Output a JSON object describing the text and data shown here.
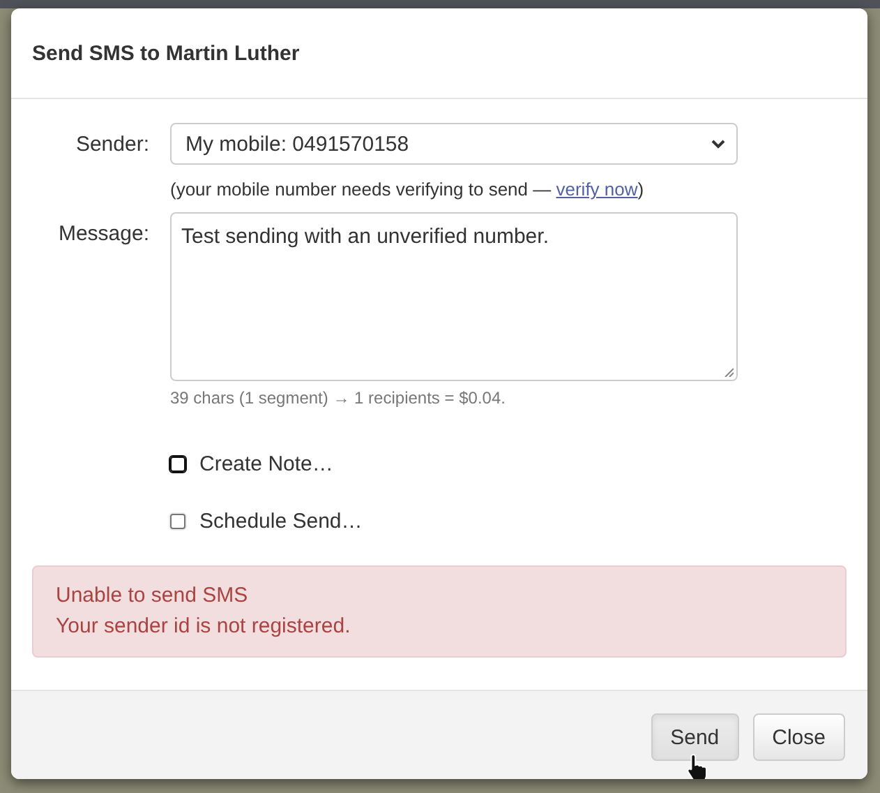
{
  "dialog": {
    "title": "Send SMS to Martin Luther"
  },
  "sender": {
    "label": "Sender:",
    "value": "My mobile: 0491570158",
    "note": "(your mobile number needs verifying to send — ",
    "link": "verify now",
    "note_end": ")"
  },
  "message": {
    "label": "Message:",
    "value": "Test sending with an unverified number.",
    "counter": "39 chars (1 segment) → 1 recipients = $0.04."
  },
  "options": [
    {
      "label": "Create Note…",
      "checked": false,
      "focused": true
    },
    {
      "label": "Schedule Send…",
      "checked": false,
      "focused": false
    }
  ],
  "alert": {
    "lines": [
      "Unable to send SMS",
      "Your sender id is not registered."
    ]
  },
  "buttons": [
    {
      "label": "Send",
      "pressed": true
    },
    {
      "label": "Close",
      "pressed": false
    }
  ]
}
